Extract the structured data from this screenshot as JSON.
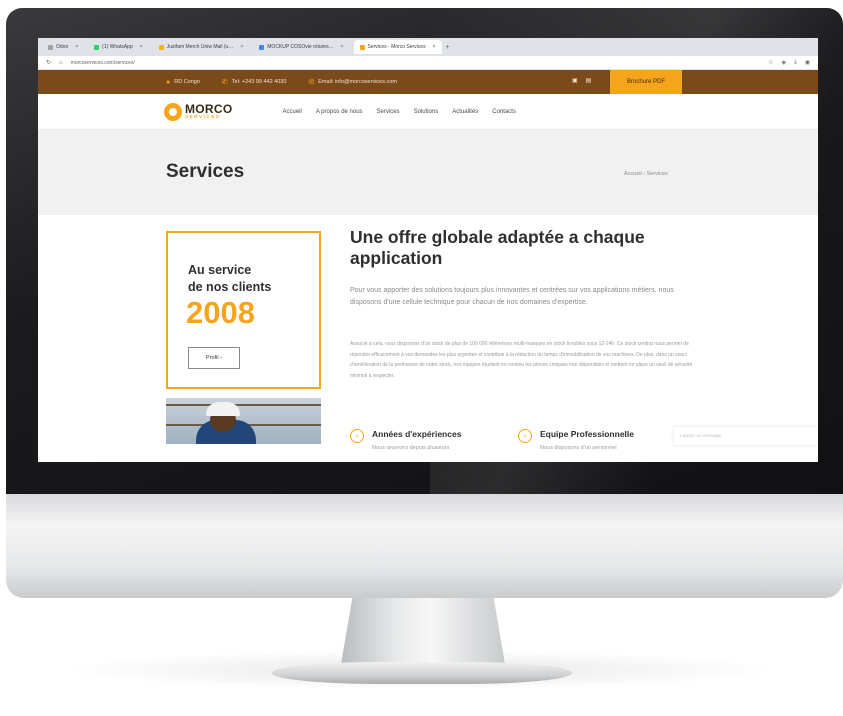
{
  "browser": {
    "tabs": [
      {
        "label": "Odoo",
        "color": "#a0a0a0"
      },
      {
        "label": "(1) WhatsApp",
        "color": "#25d366"
      },
      {
        "label": "Justfam Merch Uniw Mail (u…",
        "color": "#f4b400"
      },
      {
        "label": "MOCKUP COSOvie rotures…",
        "color": "#4285f4"
      },
      {
        "label": "Services - Morco Services",
        "color": "#f4a51c"
      }
    ],
    "new_tab": "+",
    "url": "morcoservices.com/services/"
  },
  "topbar": {
    "location": "RD Congo",
    "phone": "Tel: +243 99 442 4030",
    "email": "Email: info@morcoservices.com",
    "brochure": "Brochure PDF"
  },
  "header": {
    "logo_title": "MORCO",
    "logo_sub": "SERVICES",
    "menu": [
      "Accueil",
      "A propos de nous",
      "Services",
      "Solutions",
      "Actualités",
      "Contacts"
    ]
  },
  "title_band": {
    "title": "Services",
    "breadcrumb": "Accueil  ›  Services"
  },
  "card": {
    "line1": "Au service",
    "line2": "de nos clients",
    "year": "2008",
    "button": "Profil ›"
  },
  "content": {
    "heading": "Une offre globale adaptée a chaque application",
    "lead": "Pour vous apporter des solutions toujours plus innovantes et centrées sur vos applications métiers, nous disposons d'une cellule technique pour chacun de nos domaines d'expertise.",
    "body": "Associé à cela, nous disposons d'un stock de plus de 100 000 références multi-marques en stock livrables sous 12-24h. Ce stock central nous permet de répondre efficacement à vos demandes les plus urgentes et contribue à la réduction du temps d'immobilisation de vos machines. De plus, dans un souci d'amélioration de la pertinence de notre stock, nos équipes étudient en continu les pièces critiques non disponibles et mettent en place un seuil de sécurité minimal à respecter.",
    "features": [
      {
        "title": "Années d'expériences",
        "desc": "Nous œuvrons depuis plusieurs"
      },
      {
        "title": "Equipe Professionnelle",
        "desc": "Nous disposons d'un personnel"
      }
    ],
    "float_box": "Laissez un message"
  }
}
